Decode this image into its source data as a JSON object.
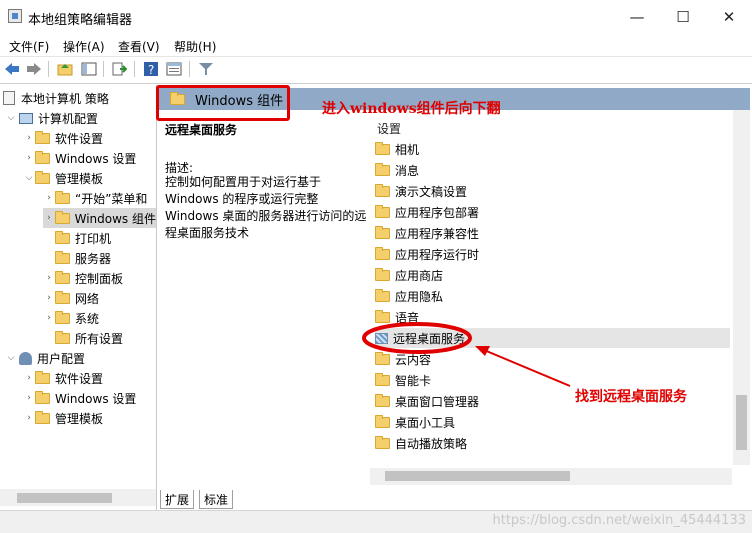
{
  "window": {
    "title": "本地组策略编辑器",
    "minimize": "—",
    "maximize": "☐",
    "close": "✕"
  },
  "menu": [
    "文件(F)",
    "操作(A)",
    "查看(V)",
    "帮助(H)"
  ],
  "toolbar": {
    "icons": [
      "back-arrow-icon",
      "forward-arrow-icon",
      "up-folder-icon",
      "show-hide-tree-icon",
      "export-list-icon",
      "help-icon",
      "properties-icon",
      "filter-icon"
    ]
  },
  "tree": {
    "root": "本地计算机 策略",
    "computer_config": "计算机配置",
    "cc_software": "软件设置",
    "cc_windows": "Windows 设置",
    "cc_admin": "管理模板",
    "start_menu": "“开始”菜单和",
    "windows_components": "Windows 组件",
    "printers": "打印机",
    "servers": "服务器",
    "control_panel": "控制面板",
    "network": "网络",
    "system": "系统",
    "all_settings": "所有设置",
    "user_config": "用户配置",
    "uc_software": "软件设置",
    "uc_windows": "Windows 设置",
    "uc_admin": "管理模板"
  },
  "right": {
    "header_title": "Windows 组件",
    "desc_title": "远程桌面服务",
    "desc_label": "描述:",
    "desc_body": "控制如何配置用于对运行基于 Windows 的程序或运行完整 Windows 桌面的服务器进行访问的远程桌面服务技术",
    "column_header": "设置",
    "items": [
      "相机",
      "消息",
      "演示文稿设置",
      "应用程序包部署",
      "应用程序兼容性",
      "应用程序运行时",
      "应用商店",
      "应用隐私",
      "语音",
      "远程桌面服务",
      "云内容",
      "智能卡",
      "桌面窗口管理器",
      "桌面小工具",
      "自动播放策略"
    ],
    "selected_index": 9
  },
  "tabs": [
    "扩展",
    "标准"
  ],
  "annotations": {
    "note1": "进入windows组件后向下翻",
    "note2": "找到远程桌面服务",
    "color": "#e00000"
  },
  "watermark": "https://blog.csdn.net/weixin_45444133"
}
